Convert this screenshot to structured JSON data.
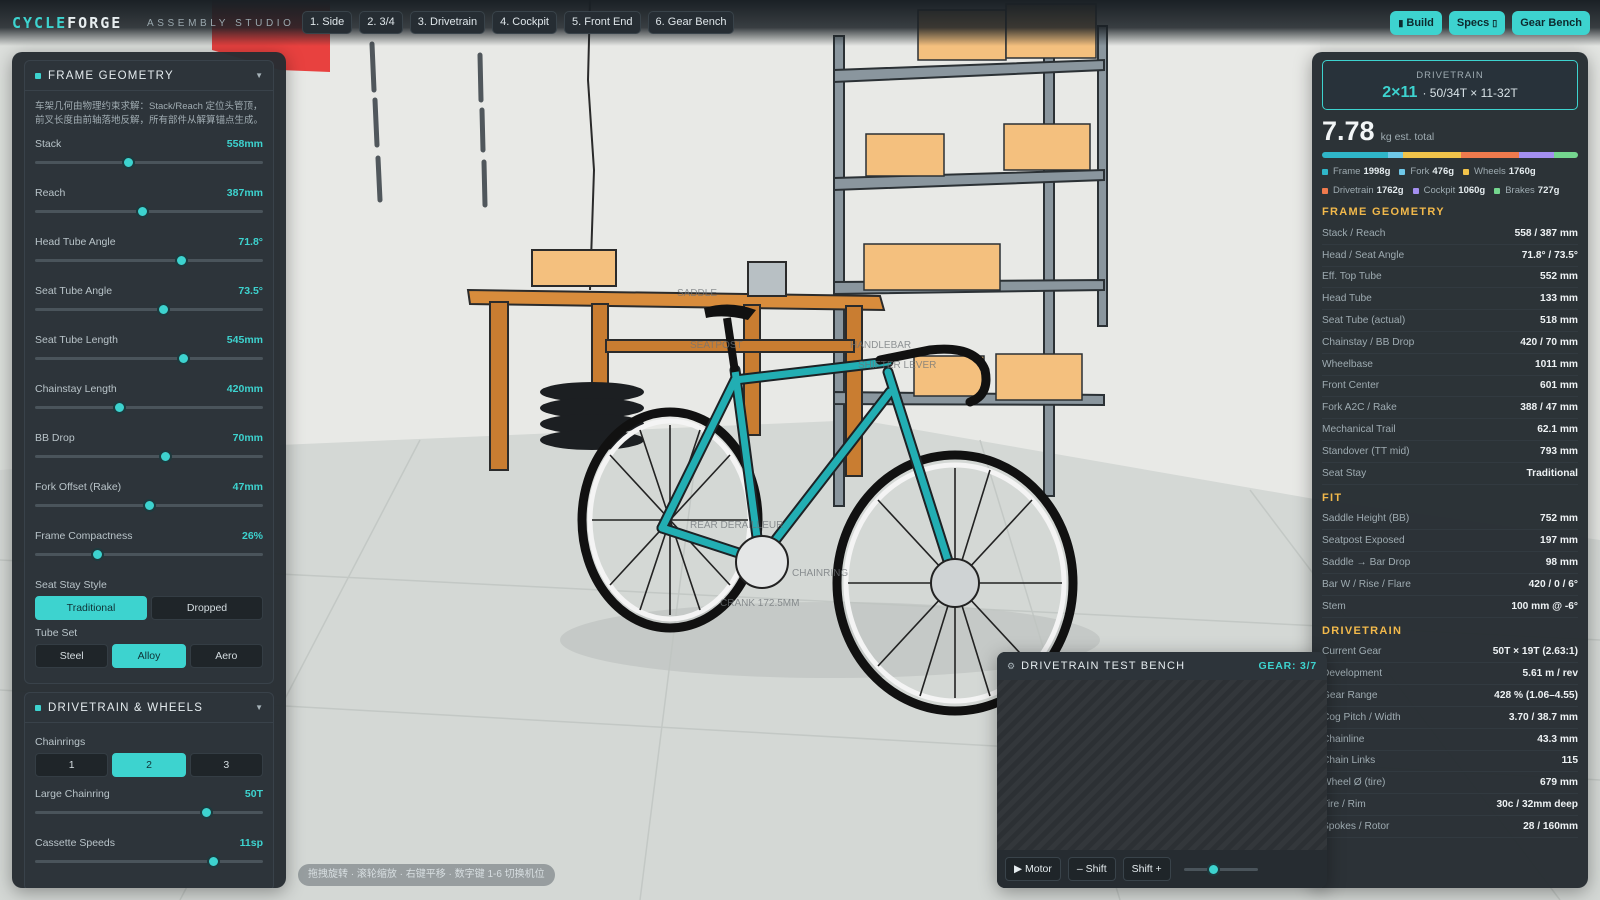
{
  "app": {
    "brand_accent": "CYCLE",
    "brand_rest": "FORGE",
    "subtitle": "ASSEMBLY STUDIO",
    "accent_color": "#3dd3cf"
  },
  "views": [
    "1. Side",
    "2. 3/4",
    "3. Drivetrain",
    "4. Cockpit",
    "5. Front End",
    "6. Gear Bench"
  ],
  "actions": [
    {
      "icon": "build-icon",
      "label": "Build"
    },
    {
      "icon": "specs-icon",
      "label": "Specs"
    },
    {
      "icon": "",
      "label": "Gear Bench"
    }
  ],
  "frame_geometry": {
    "title": "FRAME GEOMETRY",
    "description": "车架几何由物理约束求解：Stack/Reach 定位头管顶，前叉长度由前轴落地反解，所有部件从解算锚点生成。",
    "sliders": [
      {
        "label": "Stack",
        "value": "558mm",
        "level": 0.41
      },
      {
        "label": "Reach",
        "value": "387mm",
        "level": 0.47
      },
      {
        "label": "Head Tube Angle",
        "value": "71.8°",
        "level": 0.64
      },
      {
        "label": "Seat Tube Angle",
        "value": "73.5°",
        "level": 0.56
      },
      {
        "label": "Seat Tube Length",
        "value": "545mm",
        "level": 0.65
      },
      {
        "label": "Chainstay Length",
        "value": "420mm",
        "level": 0.37
      },
      {
        "label": "BB Drop",
        "value": "70mm",
        "level": 0.57
      },
      {
        "label": "Fork Offset (Rake)",
        "value": "47mm",
        "level": 0.5
      },
      {
        "label": "Frame Compactness",
        "value": "26%",
        "level": 0.27
      }
    ],
    "seat_stay": {
      "label": "Seat Stay Style",
      "options": [
        "Traditional",
        "Dropped"
      ],
      "selected": 0
    },
    "tube_set": {
      "label": "Tube Set",
      "options": [
        "Steel",
        "Alloy",
        "Aero"
      ],
      "selected": 1
    }
  },
  "drivetrain_wheels": {
    "title": "DRIVETRAIN & WHEELS",
    "chainrings": {
      "label": "Chainrings",
      "options": [
        "1",
        "2",
        "3"
      ],
      "selected": 1
    },
    "sliders": [
      {
        "label": "Large Chainring",
        "value": "50T",
        "level": 0.75
      },
      {
        "label": "Cassette Speeds",
        "value": "11sp",
        "level": 0.78
      }
    ]
  },
  "summary": {
    "drivetrain_caption": "DRIVETRAIN",
    "drivetrain_speed": "2×11",
    "drivetrain_detail": "· 50/34T × 11-32T",
    "weight": "7.78",
    "weight_unit": "kg est. total",
    "parts": [
      {
        "name": "Frame",
        "weight": "1998g",
        "grams": 1998,
        "color": "#2fb6c9"
      },
      {
        "name": "Fork",
        "weight": "476g",
        "grams": 476,
        "color": "#6fc8e8"
      },
      {
        "name": "Wheels",
        "weight": "1760g",
        "grams": 1760,
        "color": "#f1c34a"
      },
      {
        "name": "Drivetrain",
        "weight": "1762g",
        "grams": 1762,
        "color": "#ef7a4d"
      },
      {
        "name": "Cockpit",
        "weight": "1060g",
        "grams": 1060,
        "color": "#a48ff0"
      },
      {
        "name": "Brakes",
        "weight": "727g",
        "grams": 727,
        "color": "#74d68e"
      }
    ]
  },
  "specs": [
    {
      "heading": "FRAME GEOMETRY",
      "rows": [
        [
          "Stack / Reach",
          "558 / 387 mm"
        ],
        [
          "Head / Seat Angle",
          "71.8° / 73.5°"
        ],
        [
          "Eff. Top Tube",
          "552 mm"
        ],
        [
          "Head Tube",
          "133 mm"
        ],
        [
          "Seat Tube (actual)",
          "518 mm"
        ],
        [
          "Chainstay / BB Drop",
          "420 / 70 mm"
        ],
        [
          "Wheelbase",
          "1011 mm"
        ],
        [
          "Front Center",
          "601 mm"
        ],
        [
          "Fork A2C / Rake",
          "388 / 47 mm"
        ],
        [
          "Mechanical Trail",
          "62.1 mm"
        ],
        [
          "Standover (TT mid)",
          "793 mm"
        ],
        [
          "Seat Stay",
          "Traditional"
        ]
      ]
    },
    {
      "heading": "FIT",
      "rows": [
        [
          "Saddle Height (BB)",
          "752 mm"
        ],
        [
          "Seatpost Exposed",
          "197 mm"
        ],
        [
          "Saddle → Bar Drop",
          "98 mm"
        ],
        [
          "Bar W / Rise / Flare",
          "420 / 0 / 6°"
        ],
        [
          "Stem",
          "100 mm @ -6°"
        ]
      ]
    },
    {
      "heading": "DRIVETRAIN",
      "rows": [
        [
          "Current Gear",
          "50T × 19T (2.63:1)"
        ],
        [
          "Development",
          "5.61 m / rev"
        ],
        [
          "Gear Range",
          "428 % (1.06–4.55)"
        ],
        [
          "Cog Pitch / Width",
          "3.70 / 38.7 mm"
        ],
        [
          "Chainline",
          "43.3 mm"
        ],
        [
          "Chain Links",
          "115"
        ],
        [
          "Wheel Ø (tire)",
          "679 mm"
        ],
        [
          "Tire / Rim",
          "30c / 32mm deep"
        ],
        [
          "Spokes / Rotor",
          "28 / 160mm"
        ]
      ]
    }
  ],
  "bench": {
    "title": "DRIVETRAIN TEST BENCH",
    "gear": "GEAR: 3/7",
    "motor": "▶ Motor",
    "shift_down": "– Shift",
    "shift_up": "Shift +",
    "speed_level": 0.4
  },
  "scene_labels": [
    "SADDLE",
    "SEATPOST",
    "HANDLEBAR",
    "SHIFTER LEVER",
    "REAR DERAILLEUR",
    "CHAINRING",
    "CRANK 172.5MM"
  ],
  "hint": "拖拽旋转 · 滚轮缩放 · 右键平移 · 数字键 1-6 切换机位"
}
